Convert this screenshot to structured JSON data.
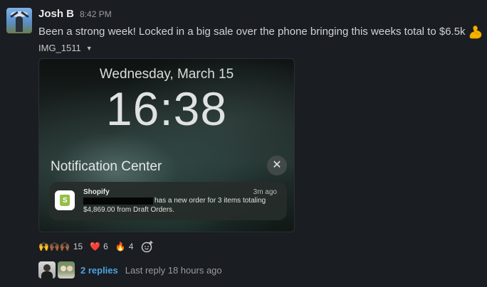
{
  "message": {
    "author": "Josh B",
    "time": "8:42 PM",
    "text": "Been a strong week! Locked in a big sale over the phone bringing this weeks total to $6.5k",
    "emoji_icon": "flexed-biceps-emoji"
  },
  "attachment": {
    "filename": "IMG_1511",
    "lockscreen": {
      "date": "Wednesday, March 15",
      "time": "16:38",
      "notification_center_title": "Notification Center",
      "close_glyph": "✕",
      "notification": {
        "app": "Shopify",
        "ago": "3m ago",
        "line1": "has a new order for 3 items totaling",
        "line2": "$4,869.00 from Draft Orders."
      }
    }
  },
  "reactions": [
    {
      "emoji": "🙌🙌🏾🙌🏾",
      "count": "15"
    },
    {
      "emoji": "❤️",
      "count": "6"
    },
    {
      "emoji": "🔥",
      "count": "4"
    }
  ],
  "thread": {
    "replies_label": "2 replies",
    "last_reply": "Last reply 18 hours ago"
  },
  "colors": {
    "background": "#1a1d21",
    "link": "#4aa3e0",
    "shopify_green": "#95bf47"
  }
}
